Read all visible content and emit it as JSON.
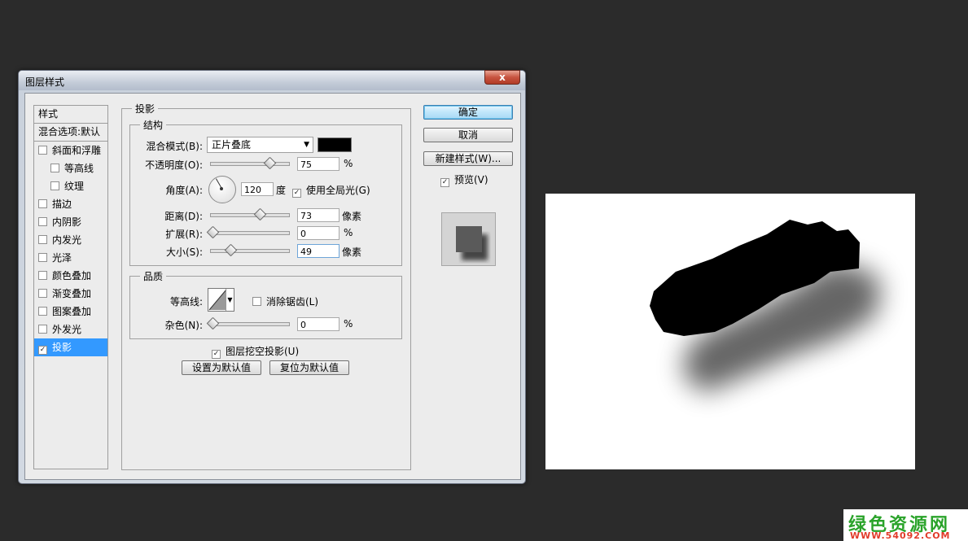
{
  "dialog": {
    "title": "图层样式",
    "close_label": "x"
  },
  "style_list": {
    "header": "样式",
    "blend_options": "混合选项:默认",
    "items": [
      {
        "label": "斜面和浮雕",
        "checked": false,
        "sub": false
      },
      {
        "label": "等高线",
        "checked": false,
        "sub": true
      },
      {
        "label": "纹理",
        "checked": false,
        "sub": true
      },
      {
        "label": "描边",
        "checked": false,
        "sub": false
      },
      {
        "label": "内阴影",
        "checked": false,
        "sub": false
      },
      {
        "label": "内发光",
        "checked": false,
        "sub": false
      },
      {
        "label": "光泽",
        "checked": false,
        "sub": false
      },
      {
        "label": "颜色叠加",
        "checked": false,
        "sub": false
      },
      {
        "label": "渐变叠加",
        "checked": false,
        "sub": false
      },
      {
        "label": "图案叠加",
        "checked": false,
        "sub": false
      },
      {
        "label": "外发光",
        "checked": false,
        "sub": false
      },
      {
        "label": "投影",
        "checked": true,
        "sub": false,
        "active": true
      }
    ]
  },
  "drop_shadow": {
    "group_title": "投影",
    "structure": {
      "title": "结构",
      "blend_mode_label": "混合模式(B):",
      "blend_mode_value": "正片叠底",
      "shadow_color": "#000000",
      "opacity_label": "不透明度(O):",
      "opacity_value": "75",
      "opacity_unit": "%",
      "angle_label": "角度(A):",
      "angle_value": "120",
      "angle_unit": "度",
      "global_light_label": "使用全局光(G)",
      "global_light_checked": true,
      "distance_label": "距离(D):",
      "distance_value": "73",
      "distance_unit": "像素",
      "spread_label": "扩展(R):",
      "spread_value": "0",
      "spread_unit": "%",
      "size_label": "大小(S):",
      "size_value": "49",
      "size_unit": "像素"
    },
    "quality": {
      "title": "品质",
      "contour_label": "等高线:",
      "anti_alias_label": "消除锯齿(L)",
      "anti_alias_checked": false,
      "noise_label": "杂色(N):",
      "noise_value": "0",
      "noise_unit": "%"
    },
    "knockout_label": "图层挖空投影(U)",
    "knockout_checked": true,
    "make_default_label": "设置为默认值",
    "reset_default_label": "复位为默认值"
  },
  "buttons": {
    "ok": "确定",
    "cancel": "取消",
    "new_style": "新建样式(W)...",
    "preview_label": "预览(V)",
    "preview_checked": true
  },
  "watermark": {
    "title": "绿色资源网",
    "url": "WWW.54092.COM"
  },
  "colors": {
    "selection": "#3399ff",
    "background": "#2b2b2b"
  }
}
